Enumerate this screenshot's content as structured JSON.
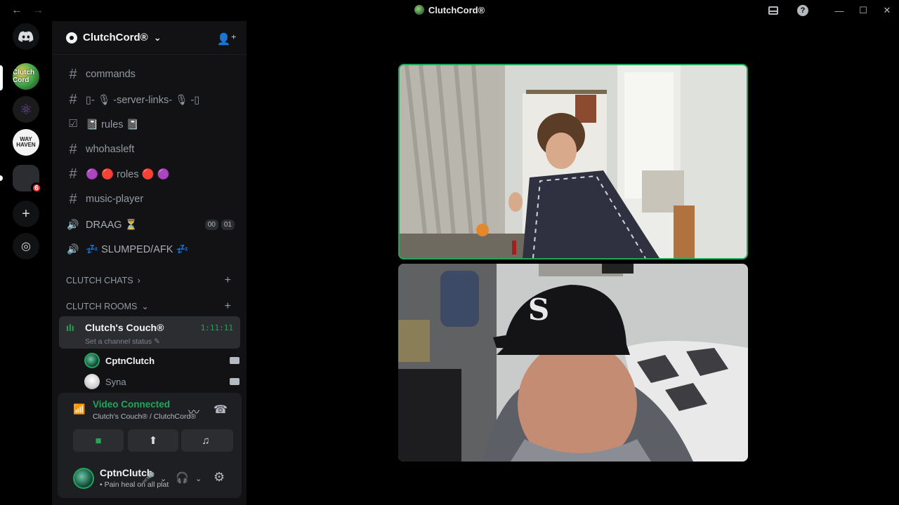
{
  "window": {
    "title": "ClutchCord®",
    "back_icon": "←",
    "forward_icon": "→",
    "help_icon": "?",
    "minimize": "—",
    "maximize": "☐",
    "close": "✕"
  },
  "guilds": {
    "c1_label": "Clutch Cord",
    "c3_label": "WAY HAVEN",
    "badge": "6",
    "add_icon": "+",
    "discover_icon": "◎"
  },
  "server": {
    "name": "ClutchCord®",
    "chevron": "⌄"
  },
  "channels": [
    {
      "prefix": "#",
      "label": "commands"
    },
    {
      "prefix": "#",
      "label": "▯- 🎙 -server-links- 🎙 -▯"
    },
    {
      "prefix": "☑",
      "label": "📓 rules 📓"
    },
    {
      "prefix": "#",
      "label": "whohasleft"
    },
    {
      "prefix": "#",
      "label": "🟣 🔴 roles 🔴 🟣"
    },
    {
      "prefix": "#",
      "label": "music-player"
    },
    {
      "prefix": "🔊",
      "label": "DRAAG ⏳",
      "counts": [
        "00",
        "01"
      ]
    },
    {
      "prefix": "🔊",
      "label": "💤 SLUMPED/AFK 💤"
    }
  ],
  "categories": [
    {
      "label": "CLUTCH CHATS",
      "chevron": "›",
      "plus": "+"
    },
    {
      "label": "CLUTCH ROOMS",
      "chevron": "⌄",
      "plus": "+"
    }
  ],
  "voice_channel": {
    "name": "Clutch's Couch®",
    "timer": "1:11:11",
    "status": "Set a channel status ✎",
    "members": [
      {
        "name": "CptnClutch"
      },
      {
        "name": "Syna"
      }
    ]
  },
  "voice_panel": {
    "title": "Video Connected",
    "subtitle": "Clutch's Couch® / ClutchCord®"
  },
  "user": {
    "name": "CptnClutch",
    "status": "• Pain heal on all plat"
  },
  "colors": {
    "accent_green": "#23a55a",
    "sidebar_bg": "#121214",
    "panel_bg": "#1e1f22"
  }
}
